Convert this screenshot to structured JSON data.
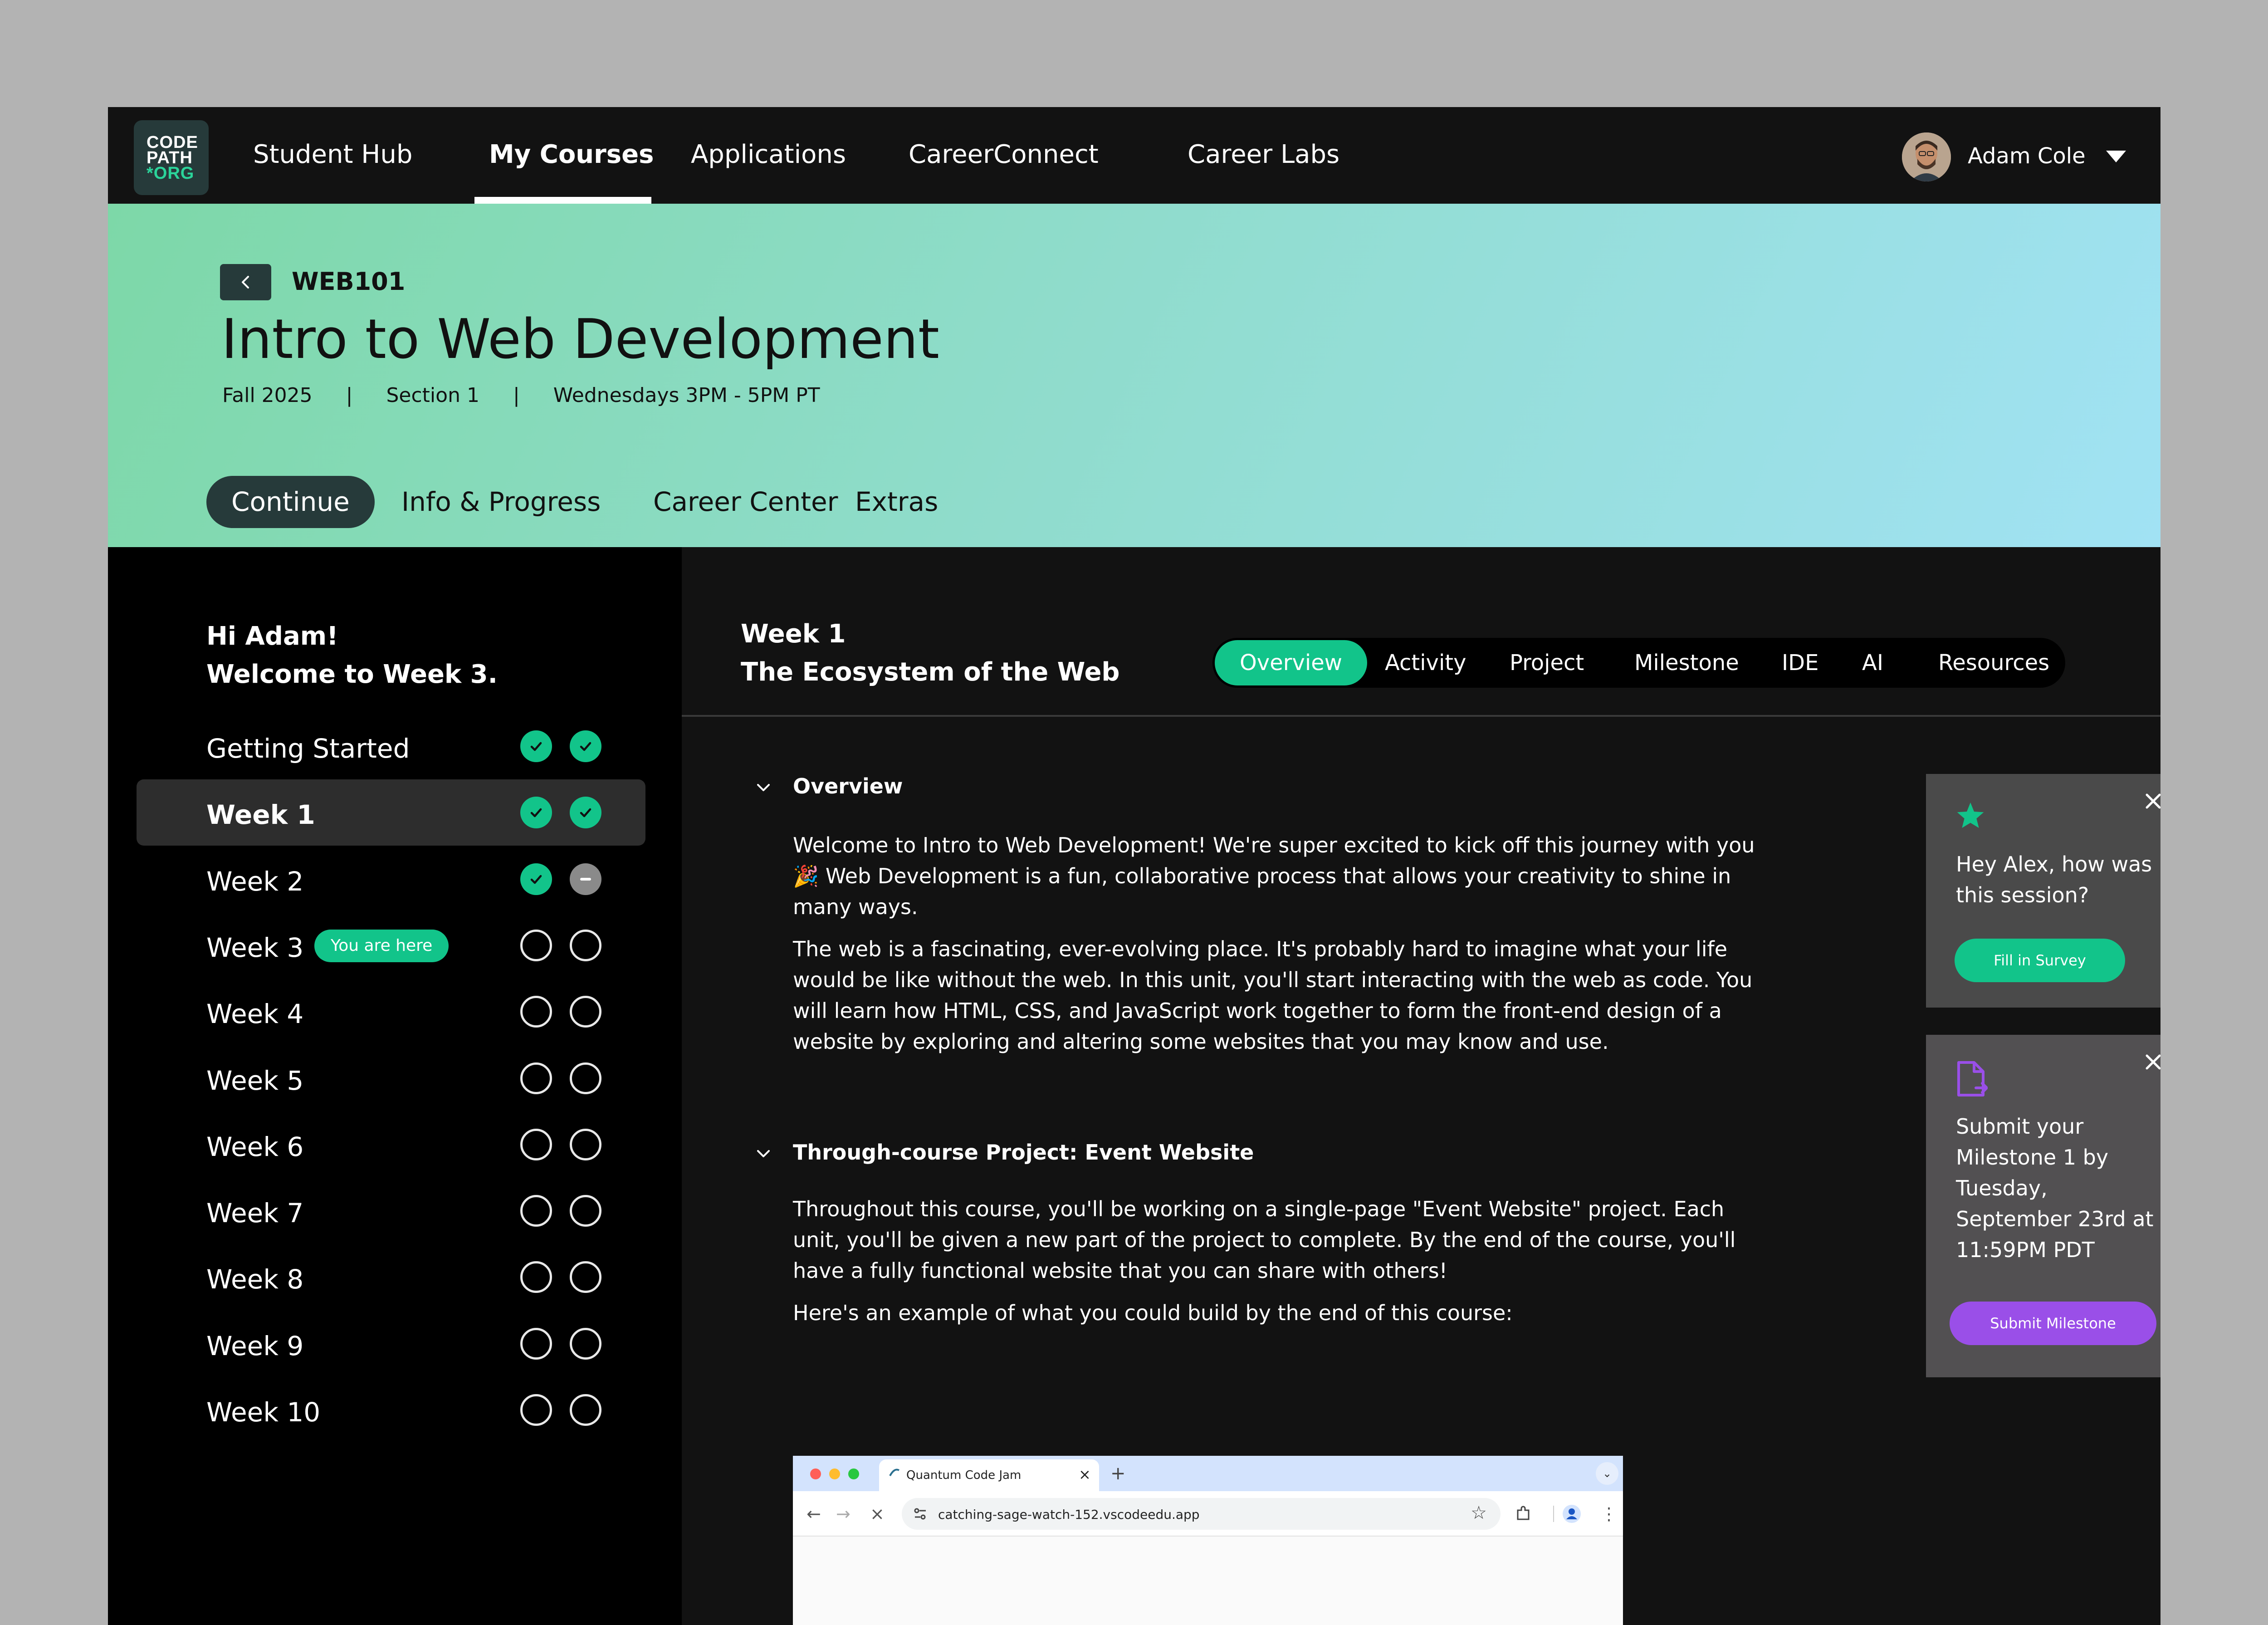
{
  "nav": {
    "logo": [
      "CODE",
      "PATH",
      "*ORG"
    ],
    "items": [
      "Student Hub",
      "My Courses",
      "Applications",
      "CareerConnect",
      "Career Labs"
    ],
    "active_item": "My Courses",
    "user_name": "Adam Cole"
  },
  "course": {
    "code": "WEB101",
    "title": "Intro to Web Development",
    "term": "Fall 2025",
    "section": "Section 1",
    "schedule": "Wednesdays 3PM - 5PM PT",
    "meta_separator": "|",
    "tabs": [
      "Continue",
      "Info & Progress",
      "Career Center",
      "Extras"
    ]
  },
  "sidebar": {
    "greeting_line1": "Hi Adam!",
    "greeting_line2": "Welcome to Week 3.",
    "you_are_here": "You are here",
    "weeks": [
      {
        "label": "Getting Started",
        "status": [
          "done",
          "done"
        ]
      },
      {
        "label": "Week 1",
        "status": [
          "done",
          "done"
        ],
        "active": true
      },
      {
        "label": "Week 2",
        "status": [
          "done",
          "partial"
        ]
      },
      {
        "label": "Week 3",
        "status": [
          "empty",
          "empty"
        ],
        "current": true
      },
      {
        "label": "Week 4",
        "status": [
          "empty",
          "empty"
        ]
      },
      {
        "label": "Week 5",
        "status": [
          "empty",
          "empty"
        ]
      },
      {
        "label": "Week 6",
        "status": [
          "empty",
          "empty"
        ]
      },
      {
        "label": "Week 7",
        "status": [
          "empty",
          "empty"
        ]
      },
      {
        "label": "Week 8",
        "status": [
          "empty",
          "empty"
        ]
      },
      {
        "label": "Week 9",
        "status": [
          "empty",
          "empty"
        ]
      },
      {
        "label": "Week 10",
        "status": [
          "empty",
          "empty"
        ]
      }
    ]
  },
  "main": {
    "week_label": "Week 1",
    "week_title": "The Ecosystem of the Web",
    "tabs": [
      "Overview",
      "Activity",
      "Project",
      "Milestone",
      "IDE",
      "AI",
      "Resources"
    ],
    "overview": {
      "title": "Overview",
      "p1": "Welcome to Intro to Web Development! We're super excited to kick off this journey with you 🎉 Web Development is a fun, collaborative process that allows your creativity to shine in many ways.",
      "p2": "The web is a fascinating, ever-evolving place. It's probably hard to imagine what your life would be like without the web. In this unit, you'll start interacting with the web as code. You will learn how HTML, CSS, and JavaScript work together to form the front-end design of a website by exploring and altering some websites that you may know and use."
    },
    "project": {
      "title": "Through-course Project: Event Website",
      "p1": "Throughout this course, you'll be working on a single-page \"Event Website\" project. Each unit, you'll be given a new part of the project to complete. By the end of the course, you'll have a fully functional website that you can share with others!",
      "p2": "Here's an example of what you could build by the end of this course:"
    },
    "browser": {
      "tab_title": "Quantum Code Jam",
      "url": "catching-sage-watch-152.vscodeedu.app"
    }
  },
  "cards": {
    "survey": {
      "text": "Hey Alex, how was this session?",
      "button": "Fill in Survey"
    },
    "milestone": {
      "text": "Submit your Milestone 1 by Tuesday, September 23rd at 11:59PM PDT",
      "button": "Submit Milestone"
    }
  },
  "colors": {
    "accent": "#12c48a",
    "purple": "#9a4fe8",
    "dark": "#263a3a"
  }
}
